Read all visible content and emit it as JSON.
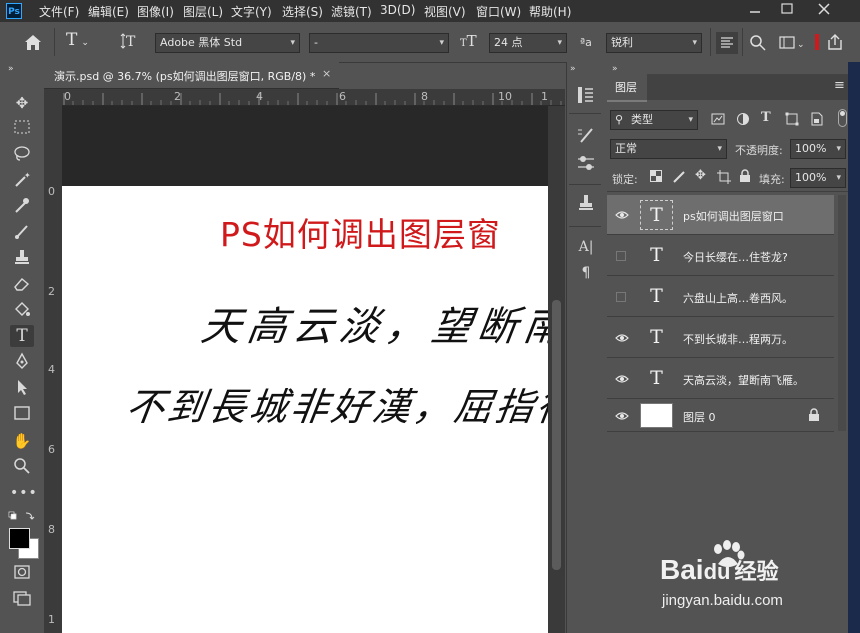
{
  "app": {
    "logo_text": "Ps"
  },
  "menu": [
    "文件(F)",
    "编辑(E)",
    "图像(I)",
    "图层(L)",
    "文字(Y)",
    "选择(S)",
    "滤镜(T)",
    "3D(D)",
    "视图(V)",
    "窗口(W)",
    "帮助(H)"
  ],
  "window_controls": [
    "minimize-icon",
    "maximize-icon",
    "close-icon"
  ],
  "options": {
    "font_family": "Adobe 黑体 Std",
    "font_style": "-",
    "font_size": "24 点",
    "aa_symbol": "ªa",
    "anti_alias": "锐利"
  },
  "document": {
    "tab_title": "演示.psd @ 36.7% (ps如何调出图层窗口, RGB/8) *",
    "close_symbol": "×",
    "ruler_top": [
      "0",
      "2",
      "4",
      "6",
      "8",
      "10",
      "1"
    ],
    "ruler_left": [
      "0",
      "2",
      "4",
      "6",
      "8",
      "1"
    ],
    "canvas_title": "PS如何调出图层窗",
    "canvas_title_color": "#d0191b",
    "calligraphy_line1": "天高云淡，望断南飛",
    "calligraphy_line2": "不到長城非好漢，屈指行"
  },
  "layers_panel": {
    "tab_label": "图层",
    "filter_label": "类型",
    "blend_mode": "正常",
    "opacity_label": "不透明度:",
    "opacity_value": "100%",
    "lock_label": "锁定:",
    "fill_label": "填充:",
    "fill_value": "100%",
    "layers": [
      {
        "name": "ps如何调出图层窗口",
        "kind": "text",
        "visible": true,
        "selected": true
      },
      {
        "name": "今日长缨在…住苍龙?",
        "kind": "text",
        "visible": false,
        "selected": false
      },
      {
        "name": "六盘山上高…卷西风。",
        "kind": "text",
        "visible": false,
        "selected": false
      },
      {
        "name": "不到长城非…程两万。",
        "kind": "text",
        "visible": true,
        "selected": false
      },
      {
        "name": "天高云淡，望断南飞雁。",
        "kind": "text",
        "visible": true,
        "selected": false
      },
      {
        "name": "图层 0",
        "kind": "raster",
        "visible": true,
        "selected": false
      }
    ]
  },
  "watermark": {
    "brand_a": "Bai",
    "brand_b": "du",
    "brand_c": "经验",
    "url": "jingyan.baidu.com"
  }
}
